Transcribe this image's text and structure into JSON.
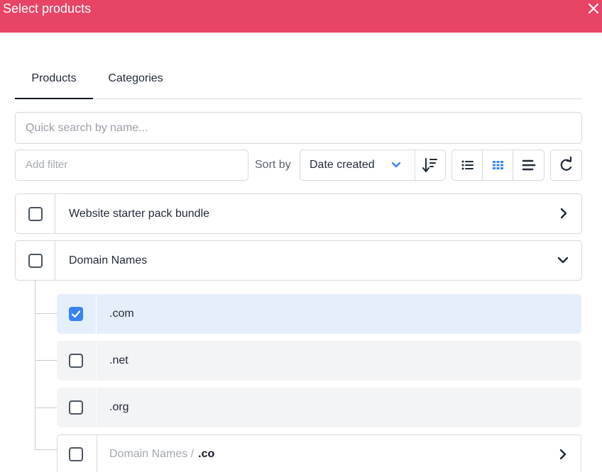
{
  "dialog": {
    "title": "Select products",
    "close_icon": "close-icon"
  },
  "tabs": [
    {
      "label": "Products",
      "active": true
    },
    {
      "label": "Categories",
      "active": false
    }
  ],
  "search": {
    "placeholder": "Quick search by name..."
  },
  "toolbar": {
    "filter_placeholder": "Add filter",
    "sort_by_label": "Sort by",
    "sort_value": "Date created",
    "sort_icon": "sort-direction-icon",
    "view_icons": [
      "list-view-icon",
      "grid-view-icon",
      "compact-view-icon"
    ],
    "active_view": "grid-view-icon",
    "refresh_icon": "refresh-icon"
  },
  "items": [
    {
      "label": "Website starter pack bundle",
      "checked": false,
      "expanded": false
    },
    {
      "label": "Domain Names",
      "checked": false,
      "expanded": true,
      "children": [
        {
          "label": ".com",
          "checked": true
        },
        {
          "label": ".net",
          "checked": false
        },
        {
          "label": ".org",
          "checked": false
        },
        {
          "breadcrumb_parent": "Domain Names /",
          "label": ".co",
          "checked": false,
          "has_children": true
        }
      ]
    }
  ],
  "colors": {
    "header": "#e84466",
    "accent": "#3b82f6",
    "selected_row": "#e5effc"
  }
}
